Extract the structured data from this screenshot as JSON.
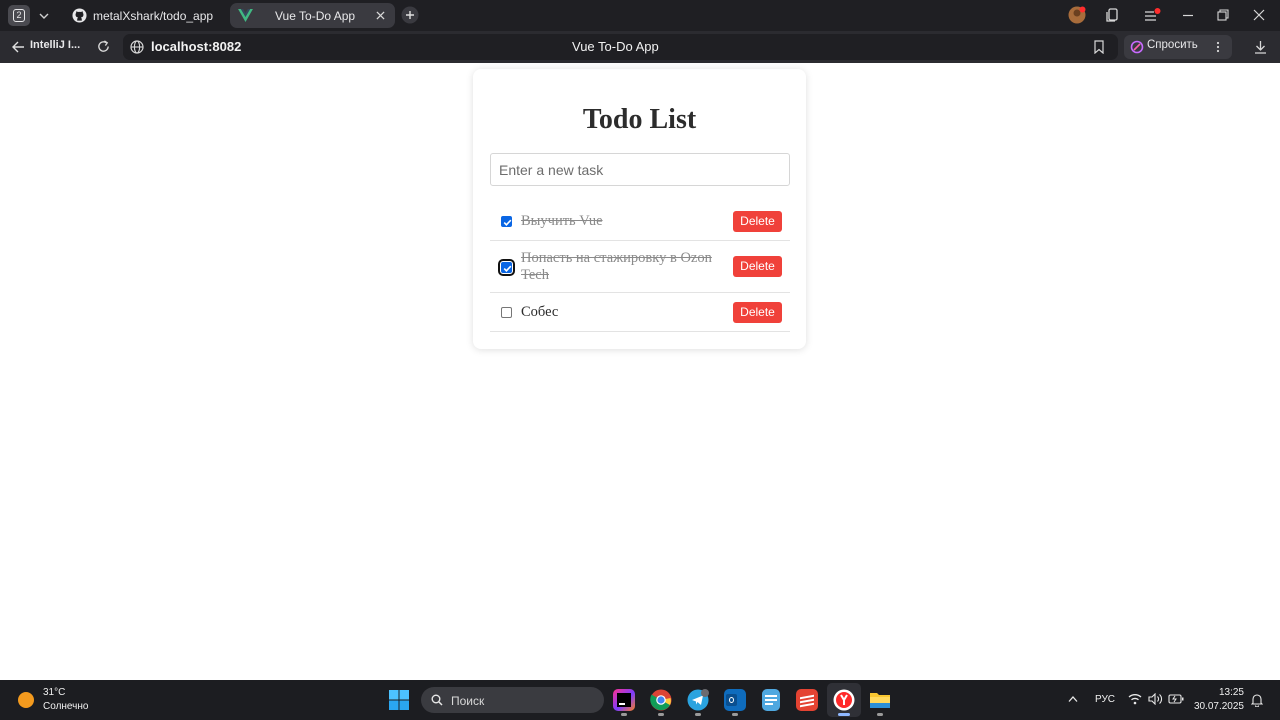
{
  "browser": {
    "tab_count": "2",
    "tabs": [
      {
        "label": "metalXshark/todo_app",
        "active": false
      },
      {
        "label": "Vue To-Do App",
        "active": true
      }
    ],
    "back_label": "IntelliJ I...",
    "url": "localhost:8082",
    "page_title": "Vue To-Do App",
    "ask_label": "Спросить"
  },
  "app": {
    "title": "Todo List",
    "input_placeholder": "Enter a new task",
    "input_value": "",
    "todos": [
      {
        "text": "Выучить Vue",
        "done": true,
        "delete_label": "Delete"
      },
      {
        "text": "Попасть на стажировку в Ozon Tech",
        "done": true,
        "focused": true,
        "delete_label": "Delete"
      },
      {
        "text": "Собес",
        "done": false,
        "delete_label": "Delete"
      }
    ]
  },
  "taskbar": {
    "weather": {
      "temp": "31°C",
      "condition": "Солнечно"
    },
    "search_label": "Поиск",
    "apps": [
      "windows-start",
      "intellij",
      "chrome",
      "telegram",
      "outlook",
      "notepad",
      "todoist",
      "yandex-browser",
      "file-explorer"
    ],
    "tray": {
      "language": "РУС",
      "time": "13:25",
      "date": "30.07.2025"
    }
  },
  "colors": {
    "delete": "#f0413a",
    "checkbox": "#0a66e4",
    "vue_green": "#41b883"
  }
}
